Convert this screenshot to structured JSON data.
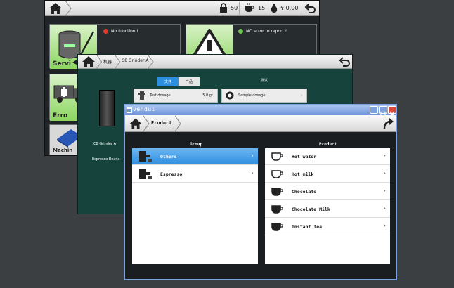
{
  "back_window": {
    "beans_count": "50",
    "cups_count": "15",
    "money": "¥ 0.00",
    "tiles": [
      {
        "message": "No function !",
        "label": "Servi",
        "status_color": "#e23a2e"
      },
      {
        "message": "NO error to report !",
        "label": "",
        "status_color": "#6cc04a"
      },
      {
        "message": "",
        "label": "Erro"
      },
      {
        "message": "",
        "label": "Machin"
      }
    ]
  },
  "middle_window": {
    "breadcrumb_1": "机器",
    "breadcrumb_2": "C8 Grinder A",
    "seg_active": "文件",
    "seg_inactive": "产品",
    "header_right": "测试",
    "test_dosage_label": "Test dosage",
    "test_dosage_value": "5.0 gr",
    "sample_dosage_label": "Sample dosage",
    "grinder_name": "C8 Grinder A",
    "grinder_sub": "Espresso Beans"
  },
  "front_window": {
    "title": "vendui",
    "nav_title": "Product",
    "group_header": "Group",
    "product_header": "Product",
    "groups": [
      {
        "label": "Others"
      },
      {
        "label": "Espresso"
      }
    ],
    "products": [
      {
        "label": "Hot water"
      },
      {
        "label": "Hot milk"
      },
      {
        "label": "Chocolate"
      },
      {
        "label": "Chocolate Milk"
      },
      {
        "label": "Instant Tea"
      }
    ],
    "arrow_glyph": "›"
  },
  "colors": {
    "selection": "#3a98e6",
    "titlebar": "#7da2df",
    "tile_green": "#8cd660",
    "middle_bg": "#17433d"
  }
}
